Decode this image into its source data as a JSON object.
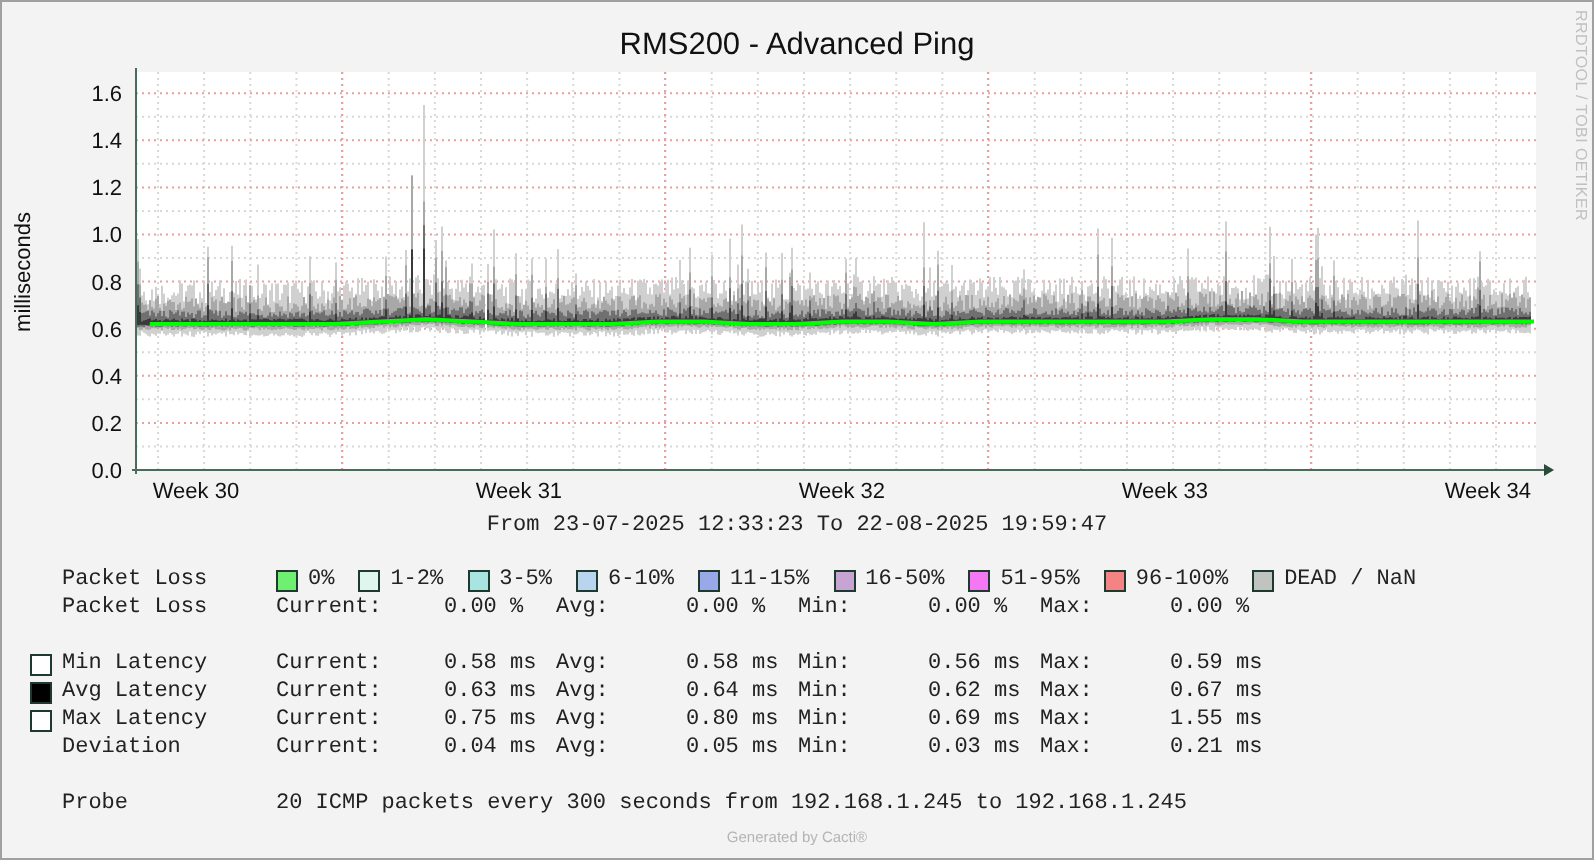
{
  "title": "RMS200 - Advanced Ping",
  "side_label": "RRDTOOL / TOBI OETIKER",
  "chart": {
    "chart_data": {
      "type": "line",
      "ylabel": "milliseconds",
      "grid": true,
      "categories": [
        null,
        "Week 30",
        null,
        null,
        null,
        null,
        null,
        null,
        "Week 31",
        null,
        null,
        null,
        null,
        null,
        null,
        "Week 32",
        null,
        null,
        null,
        null,
        null,
        null,
        "Week 33",
        null,
        null,
        null,
        null,
        null,
        null,
        "Week 34",
        null
      ],
      "ylim": [
        0,
        1.69
      ],
      "yticks": [
        {
          "value": 0,
          "label": "0.0"
        },
        {
          "value": 0.2,
          "label": "0.2"
        },
        {
          "value": 0.4,
          "label": "0.4"
        },
        {
          "value": 0.6,
          "label": "0.6"
        },
        {
          "value": 0.8,
          "label": "0.8"
        },
        {
          "value": 1.0,
          "label": "1.0"
        },
        {
          "value": 1.2,
          "label": "1.2"
        },
        {
          "value": 1.4,
          "label": "1.4"
        },
        {
          "value": 1.6,
          "label": "1.6"
        }
      ],
      "series": [
        {
          "color": "#00ff00",
          "values": [
            0.62,
            0.62,
            0.62,
            0.62,
            0.62,
            0.63,
            0.64,
            0.63,
            0.62,
            0.62,
            0.62,
            0.63,
            0.63,
            0.62,
            0.62,
            0.63,
            0.63,
            0.62,
            0.63,
            0.63,
            0.63,
            0.63,
            0.63,
            0.64,
            0.64,
            0.63,
            0.63,
            0.63,
            0.63,
            0.63,
            0.63
          ]
        }
      ]
    }
  },
  "range": "From 23-07-2025 12:33:23 To 22-08-2025 19:59:47",
  "loss_legend": {
    "label": "Packet Loss",
    "items": [
      {
        "label": "0%",
        "color": "#70f070"
      },
      {
        "label": "1-2%",
        "color": "#dff5ee"
      },
      {
        "label": "3-5%",
        "color": "#a8e4e0"
      },
      {
        "label": "6-10%",
        "color": "#b8d4ee"
      },
      {
        "label": "11-15%",
        "color": "#98a8e8"
      },
      {
        "label": "16-50%",
        "color": "#c8a4d4"
      },
      {
        "label": "51-95%",
        "color": "#f478f4"
      },
      {
        "label": "96-100%",
        "color": "#f48484"
      },
      {
        "label": "DEAD / NaN",
        "color": "#c0c4c0"
      }
    ]
  },
  "stat_groups": [
    {
      "rows": [
        {
          "label": "Packet Loss",
          "cells": [
            "Current:",
            "0.00 %",
            "Avg:",
            "0.00 %",
            "Min:",
            "0.00 %",
            "Max:",
            "0.00 %"
          ]
        }
      ]
    },
    {
      "rows": [
        {
          "label": "Min Latency",
          "color": "#ffffff",
          "cells": [
            "Current:",
            "0.58 ms",
            "Avg:",
            "0.58 ms",
            "Min:",
            "0.56 ms",
            "Max:",
            "0.59 ms"
          ]
        },
        {
          "label": "Avg Latency",
          "color": "#000000",
          "cells": [
            "Current:",
            "0.63 ms",
            "Avg:",
            "0.64 ms",
            "Min:",
            "0.62 ms",
            "Max:",
            "0.67 ms"
          ]
        },
        {
          "label": "Max Latency",
          "color": "#ffffff",
          "cells": [
            "Current:",
            "0.75 ms",
            "Avg:",
            "0.80 ms",
            "Min:",
            "0.69 ms",
            "Max:",
            "1.55 ms"
          ]
        },
        {
          "label": "Deviation",
          "cells": [
            "Current:",
            "0.04 ms",
            "Avg:",
            "0.05 ms",
            "Min:",
            "0.03 ms",
            "Max:",
            "0.21 ms"
          ]
        }
      ]
    },
    {
      "rows": [
        {
          "label": "Probe",
          "text": "20 ICMP packets every 300 seconds from 192.168.1.245 to 192.168.1.245"
        }
      ]
    }
  ],
  "footer": "Generated by Cacti®"
}
